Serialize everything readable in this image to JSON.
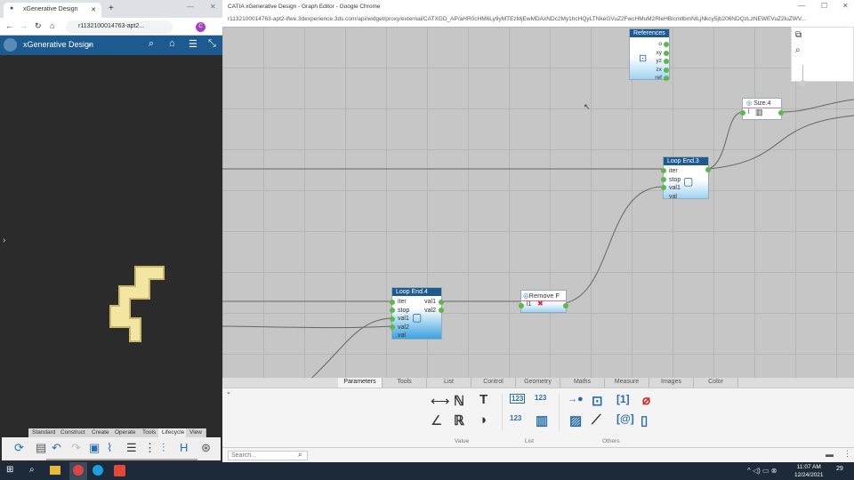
{
  "left_window": {
    "tab_title": "xGenerative Design",
    "url": "r1132100014763-apt2...",
    "profile": "C",
    "app_title": "xGenerative Design",
    "toolbar_tabs": [
      "Standard",
      "Construct",
      "Create",
      "Operate",
      "Tools",
      "Lifecycle",
      "View"
    ],
    "active_toolbar_tab": "Lifecycle"
  },
  "right_window": {
    "title": "CATIA xGenerative Design - Graph Editor - Google Chrome",
    "url": "r1132100014763-apt2-ifwe.3dexperience.3ds.com/api/widget/proxy/external/CATXGD_AP/aHR0cHM6Ly9yMTEzMjEwMDAxNDc2My1hcHQyLTNkeGVuZ2FwcHMuM2RleHBlcmllbmNlLjNkcy5jb206NDQzLzNEWEVuZ2luZWV..."
  },
  "nodes": {
    "references": {
      "title": "References",
      "ports": [
        "o",
        "xy",
        "yz",
        "zx",
        "ref"
      ]
    },
    "size": {
      "title": "Size.4",
      "input": "l"
    },
    "loop3": {
      "title": "Loop End.3",
      "ports": [
        "iter",
        "stop",
        "val1",
        "val"
      ]
    },
    "loop4": {
      "title": "Loop End.4",
      "inputs": [
        "iter",
        "stop",
        "val1",
        "val2",
        "val"
      ],
      "outputs": [
        "val1",
        "val2"
      ]
    },
    "remove": {
      "title": "Remove F",
      "input": "l1"
    }
  },
  "palette": {
    "tabs": [
      "Parameters",
      "Tools",
      "List",
      "Control",
      "Geometry",
      "Maths",
      "Measure",
      "Images",
      "Color"
    ],
    "active_tab": "Parameters",
    "groups": [
      "Value",
      "List",
      "Others"
    ]
  },
  "search": {
    "placeholder": "Search..."
  },
  "taskbar": {
    "time": "11:07 AM",
    "date": "12/24/2021",
    "notifications": "29"
  },
  "colors": {
    "header_blue": "#1d5a8f",
    "port_green": "#5bb84a",
    "shape_yellow": "#f3e6a2"
  }
}
